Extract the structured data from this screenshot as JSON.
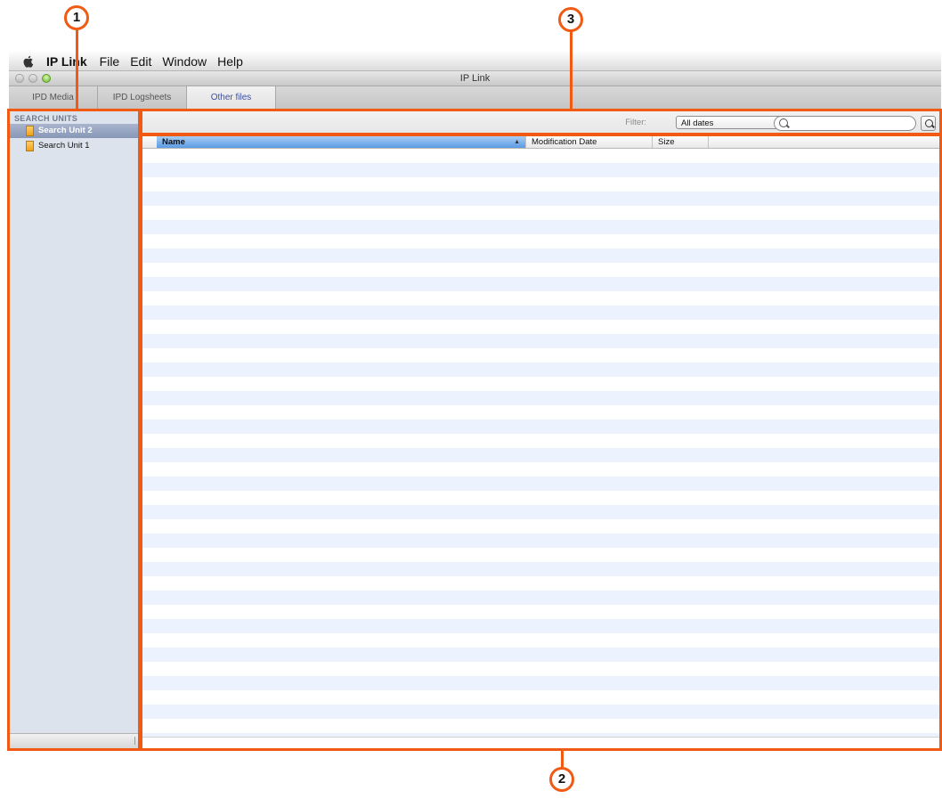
{
  "menubar": {
    "app_name": "IP Link",
    "items": [
      "File",
      "Edit",
      "Window",
      "Help"
    ]
  },
  "window": {
    "title": "IP Link"
  },
  "tabs": [
    {
      "label": "IPD Media"
    },
    {
      "label": "IPD Logsheets"
    },
    {
      "label": "Other files",
      "active": true
    }
  ],
  "sidebar": {
    "heading": "SEARCH UNITS",
    "items": [
      {
        "label": "Search Unit 2",
        "selected": true
      },
      {
        "label": "Search Unit 1",
        "selected": false
      }
    ]
  },
  "toolbar": {
    "filter_label": "Filter:",
    "filter_value": "All dates",
    "search_placeholder": ""
  },
  "table": {
    "columns": [
      "Name",
      "Modification Date",
      "Size"
    ],
    "sort_column": "Name",
    "rows": []
  },
  "callouts": [
    "1",
    "2",
    "3"
  ],
  "colors": {
    "callout": "#f15a13",
    "selection": "#8797b6",
    "stripe": "#edf3fe"
  }
}
